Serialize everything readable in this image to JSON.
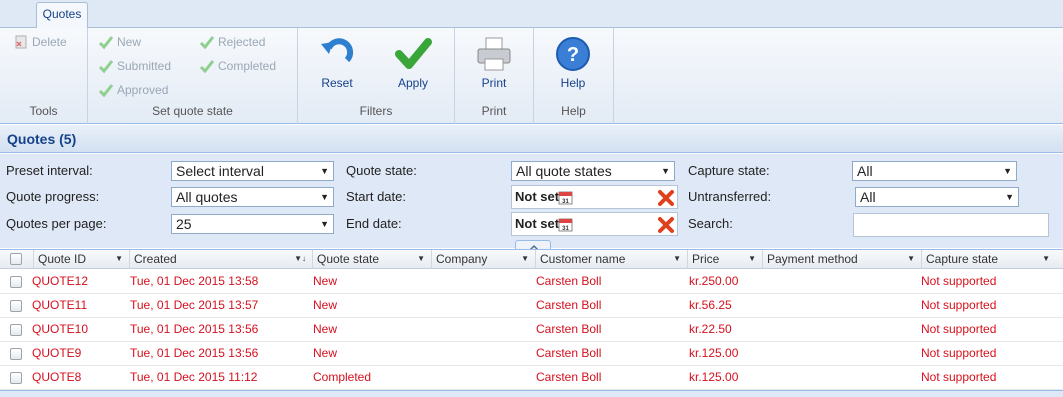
{
  "tab": {
    "label": "Quotes"
  },
  "ribbon": {
    "tools": {
      "delete_label": "Delete",
      "group_label": "Tools"
    },
    "quote_state": {
      "new": "New",
      "submitted": "Submitted",
      "approved": "Approved",
      "rejected": "Rejected",
      "completed": "Completed",
      "group_label": "Set quote state"
    },
    "filters": {
      "reset_label": "Reset",
      "apply_label": "Apply",
      "group_label": "Filters"
    },
    "print": {
      "print_label": "Print",
      "group_label": "Print"
    },
    "help": {
      "help_label": "Help",
      "group_label": "Help"
    }
  },
  "title": "Quotes (5)",
  "filters": {
    "preset_interval_label": "Preset interval:",
    "preset_interval_value": "Select interval",
    "quote_progress_label": "Quote progress:",
    "quote_progress_value": "All quotes",
    "quotes_per_page_label": "Quotes per page:",
    "quotes_per_page_value": "25",
    "quote_state_label": "Quote state:",
    "quote_state_value": "All quote states",
    "start_date_label": "Start date:",
    "start_date_value": "Not set",
    "end_date_label": "End date:",
    "end_date_value": "Not set",
    "capture_state_label": "Capture state:",
    "capture_state_value": "All",
    "untransferred_label": "Untransferred:",
    "untransferred_value": "All",
    "search_label": "Search:",
    "search_value": ""
  },
  "grid": {
    "columns": [
      "Quote ID",
      "Created",
      "Quote state",
      "Company",
      "Customer name",
      "Price",
      "Payment method",
      "Capture state"
    ],
    "rows": [
      [
        "QUOTE12",
        "Tue, 01 Dec 2015 13:58",
        "New",
        "",
        "Carsten Boll",
        "kr.250.00",
        "",
        "Not supported"
      ],
      [
        "QUOTE11",
        "Tue, 01 Dec 2015 13:57",
        "New",
        "",
        "Carsten Boll",
        "kr.56.25",
        "",
        "Not supported"
      ],
      [
        "QUOTE10",
        "Tue, 01 Dec 2015 13:56",
        "New",
        "",
        "Carsten Boll",
        "kr.22.50",
        "",
        "Not supported"
      ],
      [
        "QUOTE9",
        "Tue, 01 Dec 2015 13:56",
        "New",
        "",
        "Carsten Boll",
        "kr.125.00",
        "",
        "Not supported"
      ],
      [
        "QUOTE8",
        "Tue, 01 Dec 2015 11:12",
        "Completed",
        "",
        "Carsten Boll",
        "kr.125.00",
        "",
        "Not supported"
      ]
    ]
  },
  "colors": {
    "row_text": "#d4111e",
    "accent": "#15428b",
    "check_green": "#5cb85c"
  }
}
